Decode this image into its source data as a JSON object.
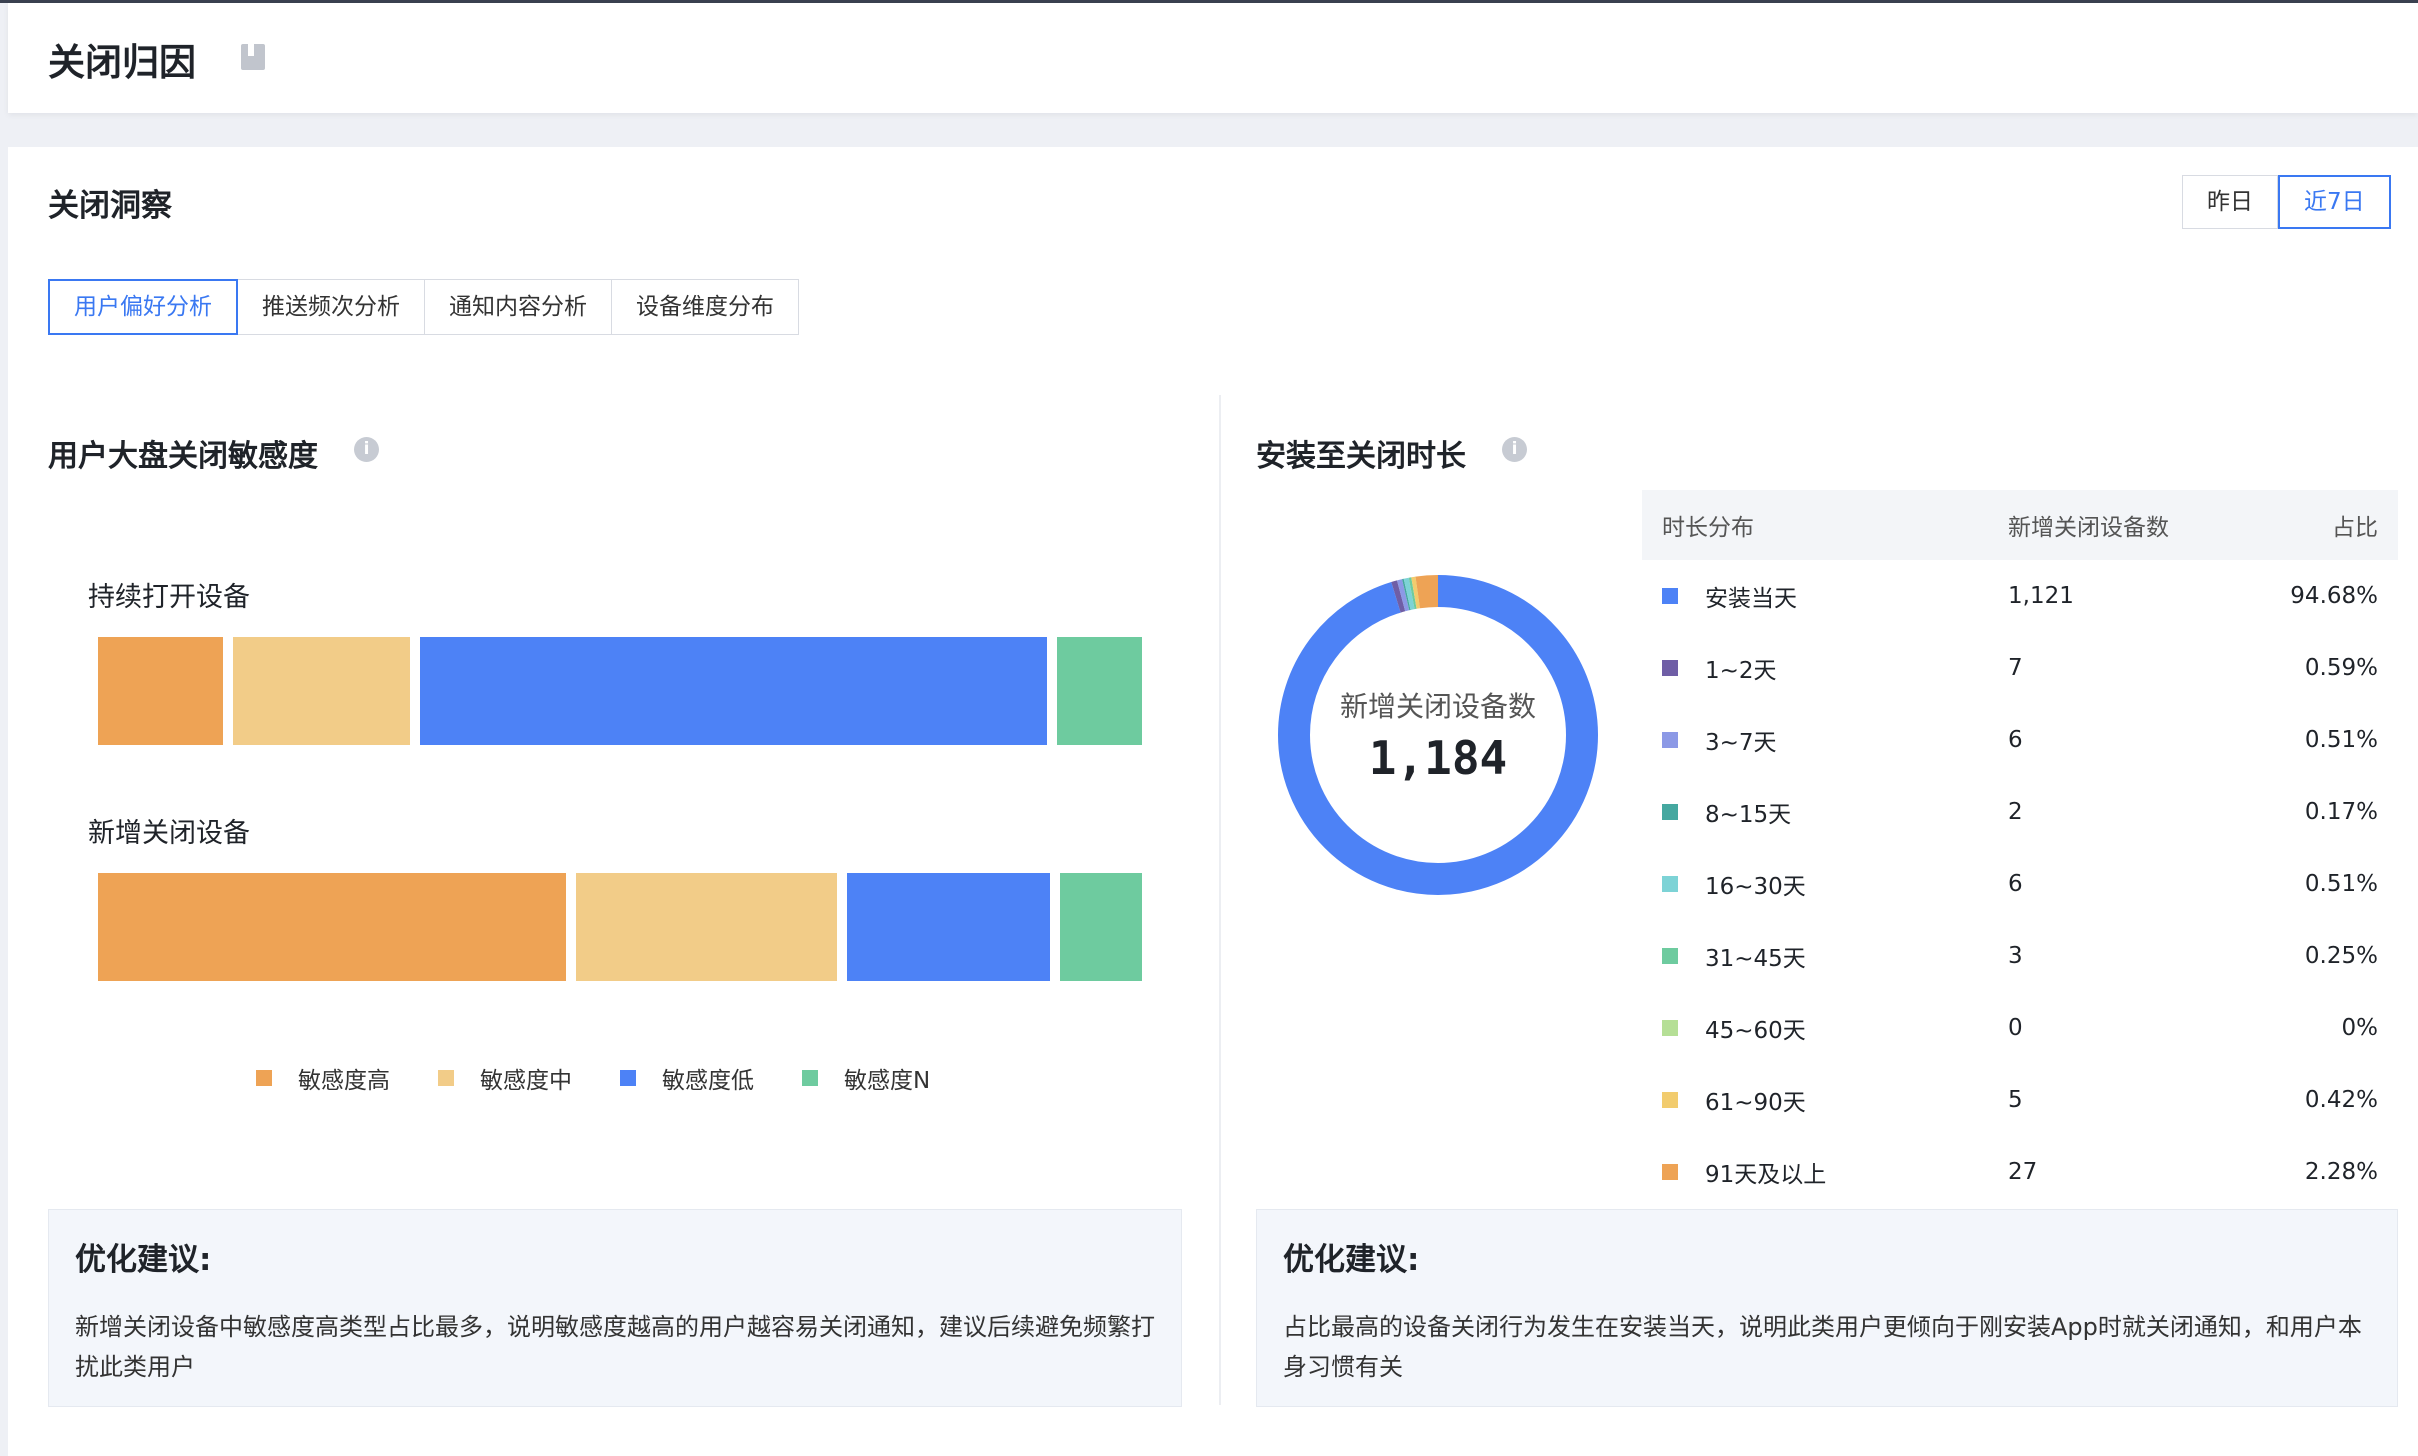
{
  "header": {
    "title": "关闭归因"
  },
  "section": {
    "title": "关闭洞察",
    "date_options": [
      "昨日",
      "近7日"
    ],
    "date_selected": "近7日",
    "tabs": [
      "用户偏好分析",
      "推送频次分析",
      "通知内容分析",
      "设备维度分布"
    ],
    "tab_selected": "用户偏好分析"
  },
  "sensitivity": {
    "title": "用户大盘关闭敏感度",
    "info_icon": "info-icon",
    "legend": [
      {
        "name": "敏感度高",
        "color": "#eea355"
      },
      {
        "name": "敏感度中",
        "color": "#f2cc88"
      },
      {
        "name": "敏感度低",
        "color": "#4d82f6"
      },
      {
        "name": "敏感度N",
        "color": "#6ecb9f"
      }
    ],
    "rows": [
      {
        "label": "持续打开设备",
        "shares": [
          0.121,
          0.17,
          0.605,
          0.082
        ]
      },
      {
        "label": "新增关闭设备",
        "shares": [
          0.451,
          0.252,
          0.196,
          0.079
        ]
      }
    ]
  },
  "duration": {
    "title": "安装至关闭时长",
    "info_icon": "info-icon",
    "donut_label": "新增关闭设备数",
    "donut_total": "1,184",
    "columns": [
      "时长分布",
      "新增关闭设备数",
      "占比"
    ],
    "rows": [
      {
        "range": "安装当天",
        "count": "1,121",
        "pct": "94.68%",
        "value": 94.68,
        "color": "#4d82f6"
      },
      {
        "range": "1~2天",
        "count": "7",
        "pct": "0.59%",
        "value": 0.59,
        "color": "#6f5ea6"
      },
      {
        "range": "3~7天",
        "count": "6",
        "pct": "0.51%",
        "value": 0.51,
        "color": "#8c99e6"
      },
      {
        "range": "8~15天",
        "count": "2",
        "pct": "0.17%",
        "value": 0.17,
        "color": "#45a8a0"
      },
      {
        "range": "16~30天",
        "count": "6",
        "pct": "0.51%",
        "value": 0.51,
        "color": "#7dd3d6"
      },
      {
        "range": "31~45天",
        "count": "3",
        "pct": "0.25%",
        "value": 0.25,
        "color": "#6ecb9f"
      },
      {
        "range": "45~60天",
        "count": "0",
        "pct": "0%",
        "value": 0,
        "color": "#b5df96"
      },
      {
        "range": "61~90天",
        "count": "5",
        "pct": "0.42%",
        "value": 0.42,
        "color": "#f2cc6e"
      },
      {
        "range": "91天及以上",
        "count": "27",
        "pct": "2.28%",
        "value": 2.28,
        "color": "#eea355"
      }
    ]
  },
  "advice_left": {
    "title": "优化建议:",
    "text": "新增关闭设备中敏感度高类型占比最多，说明敏感度越高的用户越容易关闭通知，建议后续避免频繁打扰此类用户"
  },
  "advice_right": {
    "title": "优化建议:",
    "text": "占比最高的设备关闭行为发生在安装当天，说明此类用户更倾向于刚安装App时就关闭通知，和用户本身习惯有关"
  }
}
